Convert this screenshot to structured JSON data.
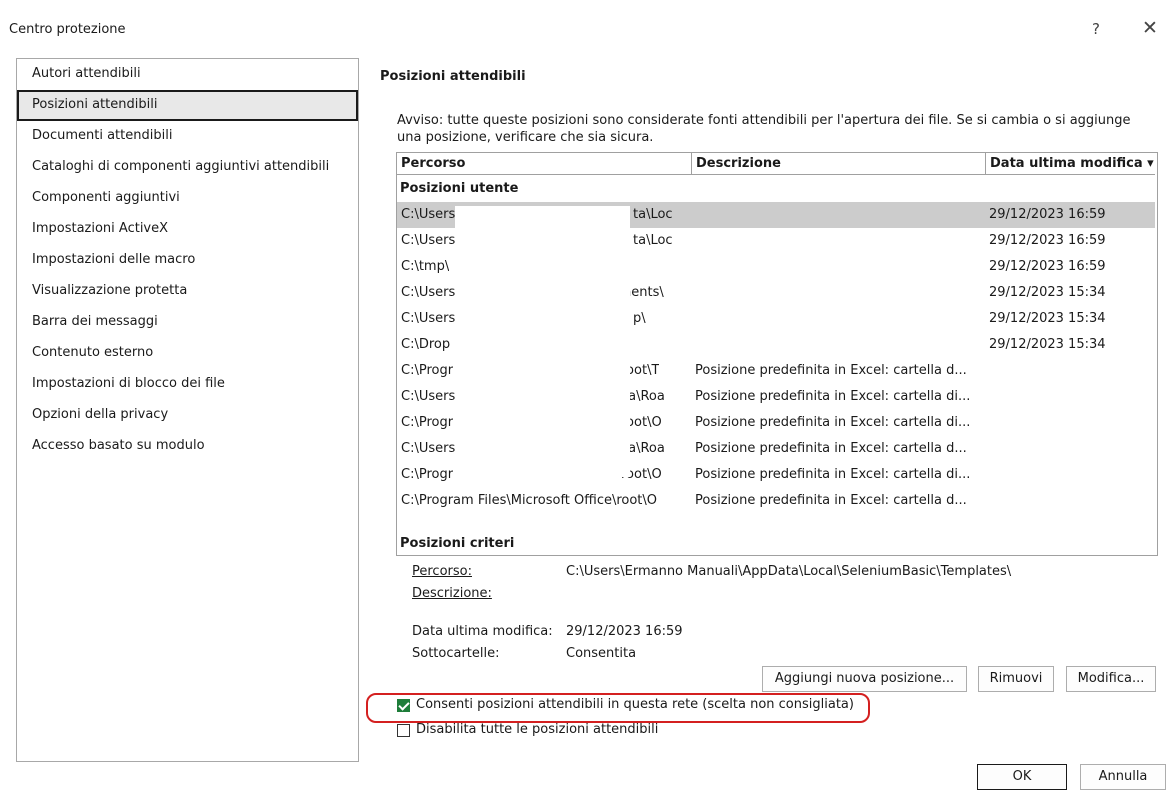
{
  "window": {
    "title": "Centro protezione",
    "help": "?",
    "close": "✕"
  },
  "nav": {
    "items": [
      {
        "label": "Autori attendibili"
      },
      {
        "label": "Posizioni attendibili"
      },
      {
        "label": "Documenti attendibili"
      },
      {
        "label": "Cataloghi di componenti aggiuntivi attendibili"
      },
      {
        "label": "Componenti aggiuntivi"
      },
      {
        "label": "Impostazioni ActiveX"
      },
      {
        "label": "Impostazioni delle macro"
      },
      {
        "label": "Visualizzazione protetta"
      },
      {
        "label": "Barra dei messaggi"
      },
      {
        "label": "Contenuto esterno"
      },
      {
        "label": "Impostazioni di blocco dei file"
      },
      {
        "label": "Opzioni della privacy"
      },
      {
        "label": "Accesso basato su modulo"
      }
    ],
    "selected_label": "Posizioni attendibili"
  },
  "main": {
    "heading": "Posizioni attendibili",
    "warning": "Avviso: tutte queste posizioni sono considerate fonti attendibili per l'apertura dei file. Se si cambia o si aggiunge una posizione, verificare che sia sicura.",
    "table": {
      "headers": {
        "path": "Percorso",
        "description": "Descrizione",
        "date": "Data ultima modifica ▾"
      },
      "user_group": "Posizioni utente",
      "rows": [
        {
          "path_a": "C:\\Users",
          "path_b": "ta\\Loc",
          "description": "",
          "date": "29/12/2023 16:59"
        },
        {
          "path_a": "C:\\Users",
          "path_b": "ta\\Loc",
          "description": "",
          "date": "29/12/2023 16:59"
        },
        {
          "path_a": "C:\\tmp\\",
          "path_b": "",
          "description": "",
          "date": "29/12/2023 16:59"
        },
        {
          "path_a": "C:\\Users",
          "path_b": "nents\\",
          "description": "",
          "date": "29/12/2023 15:34"
        },
        {
          "path_a": "C:\\Users",
          "path_b": "p\\",
          "description": "",
          "date": "29/12/2023 15:34"
        },
        {
          "path_a": "C:\\Drop",
          "path_b": "",
          "description": "",
          "date": "29/12/2023 15:34"
        },
        {
          "path_a": "C:\\Progr",
          "path_b": "root\\T",
          "description": "Posizione predefinita in Excel: cartella d...",
          "date": ""
        },
        {
          "path_a": "C:\\Users",
          "path_b": "ta\\Roa",
          "description": "Posizione predefinita in Excel: cartella di...",
          "date": ""
        },
        {
          "path_a": "C:\\Progr",
          "path_b": "root\\O",
          "description": "Posizione predefinita in Excel: cartella di...",
          "date": ""
        },
        {
          "path_a": "C:\\Users",
          "path_b": "ta\\Roa",
          "description": "Posizione predefinita in Excel: cartella d...",
          "date": ""
        },
        {
          "path_a": "C:\\Progr",
          "path_b": "root\\O",
          "description": "Posizione predefinita in Excel: cartella di...",
          "date": ""
        },
        {
          "path_a": "C:\\Program Files\\Microsoft Office\\root\\O",
          "path_b": "",
          "description": "Posizione predefinita in Excel: cartella d...",
          "date": ""
        }
      ],
      "policy_group": "Posizioni criteri"
    },
    "details": {
      "path_label": "Percorso:",
      "path_value": "C:\\Users\\Ermanno Manuali\\AppData\\Local\\SeleniumBasic\\Templates\\",
      "description_label": "Descrizione:",
      "date_label": "Data ultima modifica:",
      "date_value": "29/12/2023 16:59",
      "subfolders_label": "Sottocartelle:",
      "subfolders_value": "Consentita"
    },
    "buttons": {
      "add": "Aggiungi nuova posizione...",
      "remove": "Rimuovi",
      "modify": "Modifica..."
    },
    "checkboxes": {
      "network": {
        "label": "Consenti posizioni attendibili in questa rete (scelta non consigliata)",
        "checked": true
      },
      "disable_all": {
        "label": "Disabilita tutte le posizioni attendibili",
        "checked": false
      }
    }
  },
  "footer": {
    "ok": "OK",
    "cancel": "Annulla"
  },
  "colors": {
    "accent_check": "#1e7d3a",
    "annotation_red": "#d42020",
    "selection_gray": "#cccccc"
  }
}
